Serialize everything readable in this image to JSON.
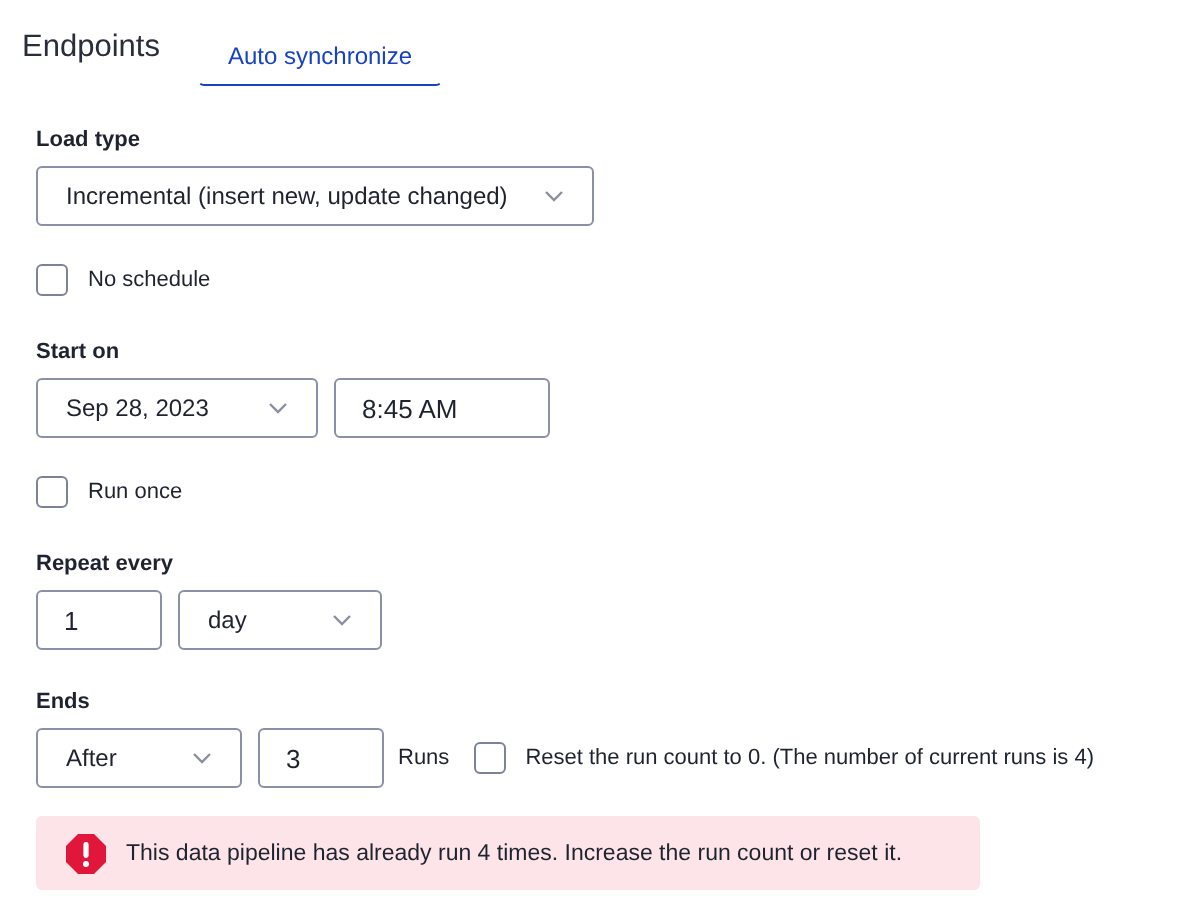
{
  "tabs": [
    {
      "label": "Endpoints",
      "selected": false
    },
    {
      "label": "Auto synchronize",
      "selected": true
    }
  ],
  "load_type": {
    "label": "Load type",
    "value": "Incremental (insert new, update changed)"
  },
  "no_schedule": {
    "label": "No schedule",
    "checked": false
  },
  "start_on": {
    "label": "Start on",
    "date": "Sep 28, 2023",
    "time": "8:45 AM"
  },
  "run_once": {
    "label": "Run once",
    "checked": false
  },
  "repeat_every": {
    "label": "Repeat every",
    "count": "1",
    "unit": "day"
  },
  "ends": {
    "label": "Ends",
    "mode": "After",
    "count": "3",
    "count_suffix": "Runs",
    "reset": {
      "label": "Reset the run count to 0. (The number of current runs is 4)",
      "checked": false
    }
  },
  "alert": {
    "kind": "error",
    "message": "This data pipeline has already run 4 times. Increase the run count or reset it."
  }
}
